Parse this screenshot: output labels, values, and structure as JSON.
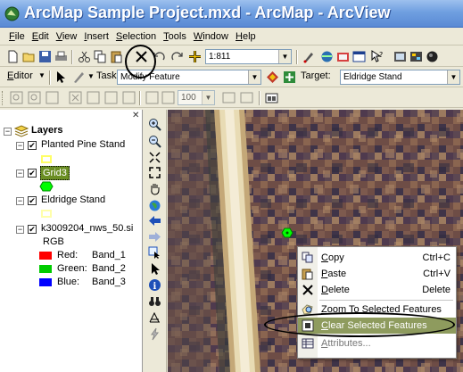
{
  "window": {
    "title": "ArcMap Sample Project.mxd - ArcMap - ArcView"
  },
  "menubar": {
    "items": [
      "File",
      "Edit",
      "View",
      "Insert",
      "Selection",
      "Tools",
      "Window",
      "Help"
    ]
  },
  "standard_toolbar": {
    "scale": "1:811",
    "icons": [
      "new-icon",
      "open-icon",
      "save-icon",
      "print-icon",
      "cut-icon",
      "copy-icon",
      "paste-icon",
      "delete-icon",
      "undo-icon",
      "redo-icon",
      "add-data-icon",
      "editor-toolbar-icon",
      "arctoolbox-icon",
      "arccatalog-icon",
      "window-icon",
      "whats-this-icon"
    ]
  },
  "editor_toolbar": {
    "editor_label": "Editor",
    "task_label": "Task:",
    "task_value": "Modify Feature",
    "target_label": "Target:",
    "target_value": "Eldridge Stand"
  },
  "layout_toolbar": {
    "zoom_value": "100"
  },
  "toc": {
    "root_label": "Layers",
    "layers": [
      {
        "name": "Planted Pine Stand",
        "checked": true,
        "symbol_color": "#ffff66",
        "symbol_type": "rect"
      },
      {
        "name": "Grid3",
        "checked": true,
        "selected": true,
        "symbol_color": "#00ff00",
        "symbol_type": "hexagon"
      },
      {
        "name": "Eldridge Stand",
        "checked": true,
        "symbol_color": "#ffffaa",
        "symbol_type": "rect"
      },
      {
        "name": "k3009204_nws_50.si",
        "checked": true,
        "raster": {
          "label": "RGB",
          "bands": [
            {
              "channel": "Red:",
              "band": "Band_1",
              "color": "#ff0000"
            },
            {
              "channel": "Green:",
              "band": "Band_2",
              "color": "#00cc00"
            },
            {
              "channel": "Blue:",
              "band": "Band_3",
              "color": "#0000ff"
            }
          ]
        }
      }
    ]
  },
  "tools": [
    "zoom-in-icon",
    "zoom-out-icon",
    "fixed-zoom-in-icon",
    "fixed-zoom-out-icon",
    "pan-icon",
    "full-extent-icon",
    "back-extent-icon",
    "forward-extent-icon",
    "select-features-icon",
    "select-elements-icon",
    "identify-icon",
    "find-icon",
    "measure-icon",
    "hyperlink-icon"
  ],
  "context_menu": {
    "items": [
      {
        "label": "Copy",
        "shortcut": "Ctrl+C",
        "icon": "copy-icon"
      },
      {
        "label": "Paste",
        "shortcut": "Ctrl+V",
        "icon": "paste-icon"
      },
      {
        "label": "Delete",
        "shortcut": "Delete",
        "icon": "delete-icon"
      },
      {
        "label": "Zoom To Selected Features",
        "shortcut": "",
        "icon": "zoom-to-selected-icon"
      },
      {
        "label": "Clear Selected Features",
        "shortcut": "",
        "icon": "clear-selection-icon",
        "highlighted": true
      },
      {
        "label": "Attributes...",
        "shortcut": "",
        "icon": "attributes-icon"
      }
    ]
  },
  "colors": {
    "titlebar": "#6f9fe0",
    "toc_selected": "#6b8e23",
    "menu_highlight": "#8e9b5e",
    "selected_feature": "#00ff00"
  }
}
